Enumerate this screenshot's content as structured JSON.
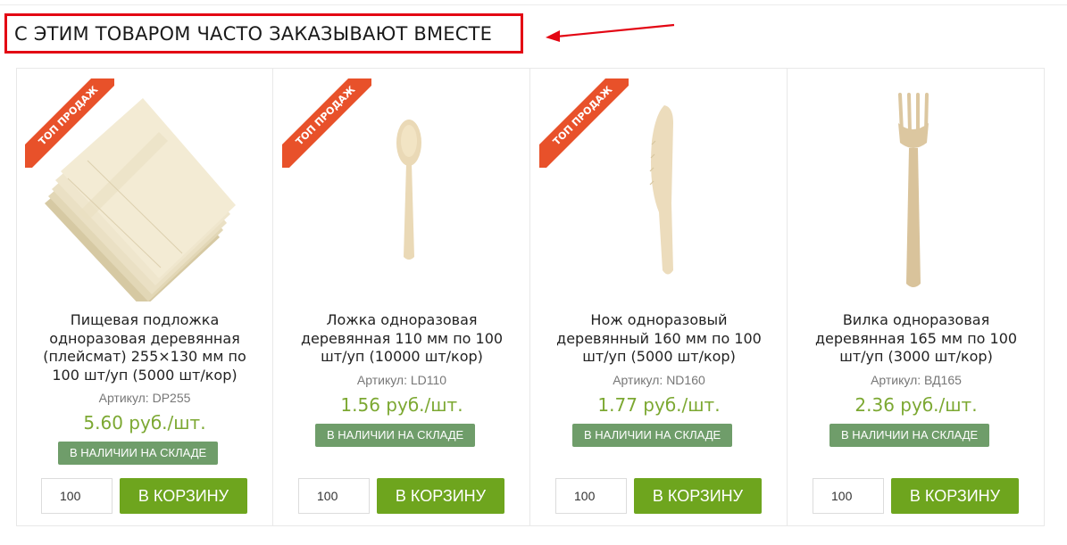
{
  "section": {
    "heading": "С ЭТИМ ТОВАРОМ ЧАСТО ЗАКАЗЫВАЮТ ВМЕСТЕ",
    "annotation_color": "#e30613"
  },
  "products": [
    {
      "badge": "ТОП ПРОДАЖ",
      "image_icon": "wooden-placemat-icon",
      "title": "Пищевая подложка одноразовая деревянная (плейсмат) 255×130 мм по 100 шт/уп (5000 шт/кор)",
      "sku": "Артикул: DP255",
      "price": "5.60 руб./шт.",
      "stock": "В НАЛИЧИИ НА СКЛАДЕ",
      "qty": "100",
      "cart": "В КОРЗИНУ"
    },
    {
      "badge": "ТОП ПРОДАЖ",
      "image_icon": "wooden-spoon-icon",
      "title": "Ложка одноразовая деревянная 110 мм по 100 шт/уп (10000 шт/кор)",
      "sku": "Артикул: LD110",
      "price": "1.56 руб./шт.",
      "stock": "В НАЛИЧИИ НА СКЛАДЕ",
      "qty": "100",
      "cart": "В КОРЗИНУ"
    },
    {
      "badge": "ТОП ПРОДАЖ",
      "image_icon": "wooden-knife-icon",
      "title": "Нож одноразовый деревянный 160 мм по 100 шт/уп (5000 шт/кор)",
      "sku": "Артикул: ND160",
      "price": "1.77 руб./шт.",
      "stock": "В НАЛИЧИИ НА СКЛАДЕ",
      "qty": "100",
      "cart": "В КОРЗИНУ"
    },
    {
      "badge": "",
      "image_icon": "wooden-fork-icon",
      "title": "Вилка одноразовая деревянная 165 мм по 100 шт/уп (3000 шт/кор)",
      "sku": "Артикул: ВД165",
      "price": "2.36 руб./шт.",
      "stock": "В НАЛИЧИИ НА СКЛАДЕ",
      "qty": "100",
      "cart": "В КОРЗИНУ"
    }
  ],
  "colors": {
    "badge": "#e8512a",
    "price": "#7ca832",
    "stock_badge": "#6f9d6a",
    "cart_button": "#6ea51e"
  }
}
